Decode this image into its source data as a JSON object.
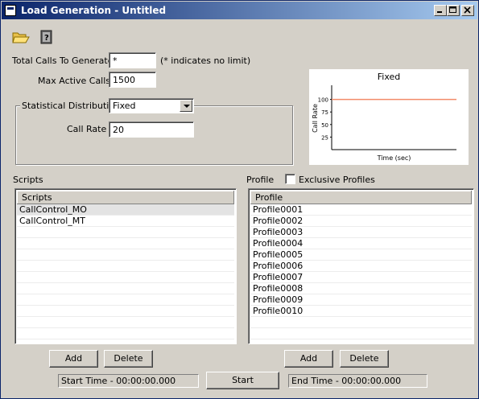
{
  "window": {
    "title": "Load Generation - Untitled"
  },
  "toolbar": {
    "open_icon": "folder-open-icon",
    "help_icon": "help-book-icon"
  },
  "form": {
    "total_calls_label": "Total Calls To Generate",
    "total_calls_value": "*",
    "total_calls_hint": "(* indicates no limit)",
    "max_active_label": "Max Active Calls",
    "max_active_value": "1500",
    "distribution_label": "Statistical Distribution",
    "distribution_value": "Fixed",
    "call_rate_label": "Call Rate",
    "call_rate_value": "20"
  },
  "preview": {
    "chart_data": {
      "type": "line",
      "title": "Fixed",
      "xlabel": "Time (sec)",
      "ylabel": "Call Rate",
      "y_ticks": [
        "100",
        "75",
        "50",
        "25"
      ],
      "ylim": [
        0,
        125
      ],
      "series": [
        {
          "values": [
            100,
            100
          ]
        }
      ],
      "line_color": "#f28b6a"
    }
  },
  "scripts": {
    "section_label": "Scripts",
    "column_header": "Scripts",
    "items": [
      "CallControl_MO",
      "CallControl_MT"
    ],
    "selected_index": 0,
    "add_label": "Add",
    "delete_label": "Delete"
  },
  "profiles": {
    "section_label": "Profile",
    "exclusive_label": "Exclusive Profiles",
    "exclusive_checked": false,
    "column_header": "Profile",
    "items": [
      "Profile0001",
      "Profile0002",
      "Profile0003",
      "Profile0004",
      "Profile0005",
      "Profile0006",
      "Profile0007",
      "Profile0008",
      "Profile0009",
      "Profile0010"
    ],
    "add_label": "Add",
    "delete_label": "Delete"
  },
  "footer": {
    "start_time": "Start Time - 00:00:00.000",
    "start_label": "Start",
    "end_time": "End Time - 00:00:00.000"
  }
}
